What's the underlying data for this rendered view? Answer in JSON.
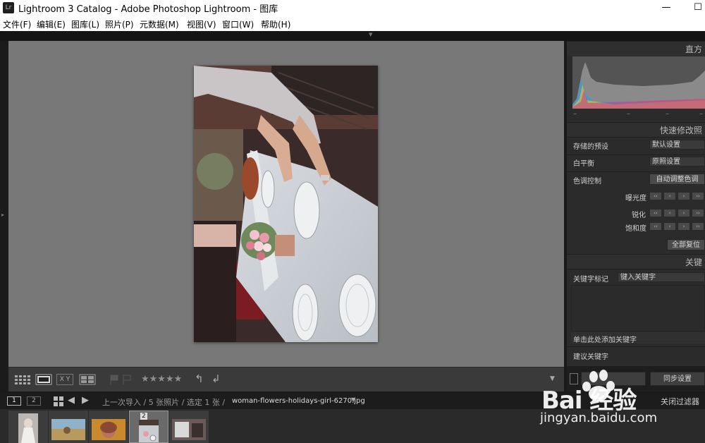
{
  "window": {
    "title": "Lightroom 3 Catalog - Adobe Photoshop Lightroom - 图库",
    "minimize_glyph": "—",
    "maximize_glyph": "☐"
  },
  "menu": [
    {
      "label": "文件(F)"
    },
    {
      "label": "编辑(E)"
    },
    {
      "label": "图库(L)"
    },
    {
      "label": "照片(P)"
    },
    {
      "label": "元数据(M)"
    },
    {
      "label": "视图(V)"
    },
    {
      "label": "窗口(W)"
    },
    {
      "label": "帮助(H)"
    }
  ],
  "toolbar": {
    "rating_stars": "★★★★★",
    "view_grid_icon": "grid-view-icon",
    "view_loupe_icon": "loupe-view-icon",
    "view_compare_label": "X Y",
    "view_survey_icon": "survey-view-icon",
    "rating_value": 0
  },
  "right_panel": {
    "histogram_header": "直方",
    "histogram_ticks": [
      "–",
      "–",
      "–",
      "–"
    ],
    "quick_develop_header": "快速修改照",
    "saved_preset_label": "存储的预设",
    "saved_preset_value": "默认设置",
    "white_balance_label": "白平衡",
    "white_balance_value": "原照设置",
    "tone_control_label": "色调控制",
    "auto_tone_button": "自动调整色调",
    "exposure_label": "曝光度",
    "sharpen_label": "锐化",
    "saturation_label": "饱和度",
    "reset_all_button": "全部复位",
    "keywording_header": "关键",
    "keyword_tags_label": "关键字标记",
    "keyword_tags_value": "键入关键字",
    "add_keyword_hint": "单击此处添加关键字",
    "suggested_keywords_label": "建议关键字",
    "sync_settings_button": "同步设置"
  },
  "filmstrip_bar": {
    "page1": "1",
    "page2": "2",
    "source_info": "上一次导入 / 5 张照片 / 选定 1 张 /",
    "filename": "woman-flowers-holidays-girl-6270.jpg",
    "filter_label": "关闭过滤器"
  },
  "filmstrip": {
    "selected_badge": "2",
    "thumbnails": [
      {
        "name": "bride-photo",
        "selected": false
      },
      {
        "name": "beach-photo",
        "selected": false
      },
      {
        "name": "portrait-photo",
        "selected": false
      },
      {
        "name": "table-flowers-photo",
        "selected": true
      },
      {
        "name": "woman-photo",
        "selected": false
      }
    ]
  },
  "watermark": {
    "brand_text": "Bai 经验",
    "url_text": "jingyan.baidu.com"
  },
  "colors": {
    "viewport_bg": "#787878",
    "panel_bg": "#2b2b2b",
    "titlebar_bg": "#ffffff"
  }
}
